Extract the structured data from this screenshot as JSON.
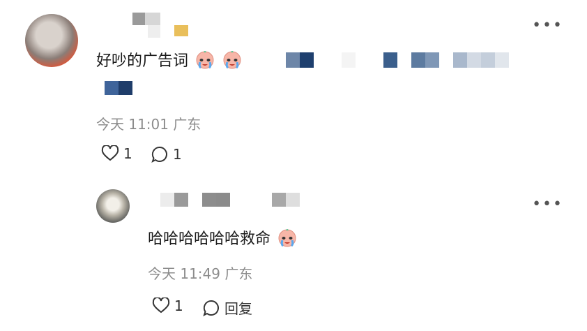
{
  "comments": [
    {
      "text": "好吵的广告词",
      "meta": "今天 11:01 广东",
      "likes": "1",
      "replies": "1",
      "emoji": [
        "crying-emoji",
        "crying-emoji"
      ]
    },
    {
      "text": "哈哈哈哈哈哈救命",
      "meta": "今天 11:49 广东",
      "likes": "1",
      "reply_label": "回复",
      "emoji": [
        "crying-emoji"
      ]
    }
  ]
}
